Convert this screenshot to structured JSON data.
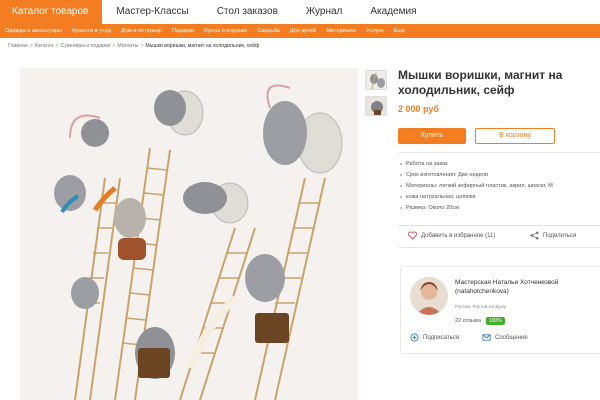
{
  "topnav": {
    "tabs": [
      {
        "label": "Каталог товаров",
        "active": true
      },
      {
        "label": "Мастер-Классы"
      },
      {
        "label": "Стол заказов"
      },
      {
        "label": "Журнал"
      },
      {
        "label": "Академия"
      }
    ]
  },
  "subnav": {
    "items": [
      "Одежда и аксессуары",
      "Красота и уход",
      "Дом и интерьер",
      "Подарки",
      "Куклы и игрушки",
      "Свадьба",
      "Для детей",
      "Материалы",
      "Услуги",
      "Еще"
    ]
  },
  "breadcrumb": {
    "items": [
      "Главная",
      "Каталог",
      "Сувениры и подарки",
      "Магниты"
    ],
    "current": "Мышки воришки, магнит на холодильник, сейф",
    "separator": ">"
  },
  "product": {
    "title": "Мышки воришки, магнит на холодильник, сейф",
    "price": "2 000 руб",
    "buy_label": "Купить",
    "cart_label": "В корзину",
    "specs": [
      "Работа на заказ",
      "Срок изготовления: Две недели",
      "Материалы: легкий зефирный пластик, акрил, шпагат, М",
      "кожа натуральная, шляпки",
      "Размер: Около 20см"
    ],
    "favorite_label": "Добавить в избранное (11)",
    "share_label": "Поделиться"
  },
  "seller": {
    "name": "Мастерская Натальи Хотченковой (natahotchenkova)",
    "location": "Россия, Ростов-на-Дону",
    "reviews": "22 отзыва",
    "rating_badge": "100%",
    "subscribe_label": "Подписаться",
    "message_label": "Сообщение"
  },
  "colors": {
    "accent": "#f47d21",
    "badge": "#43b02a"
  }
}
